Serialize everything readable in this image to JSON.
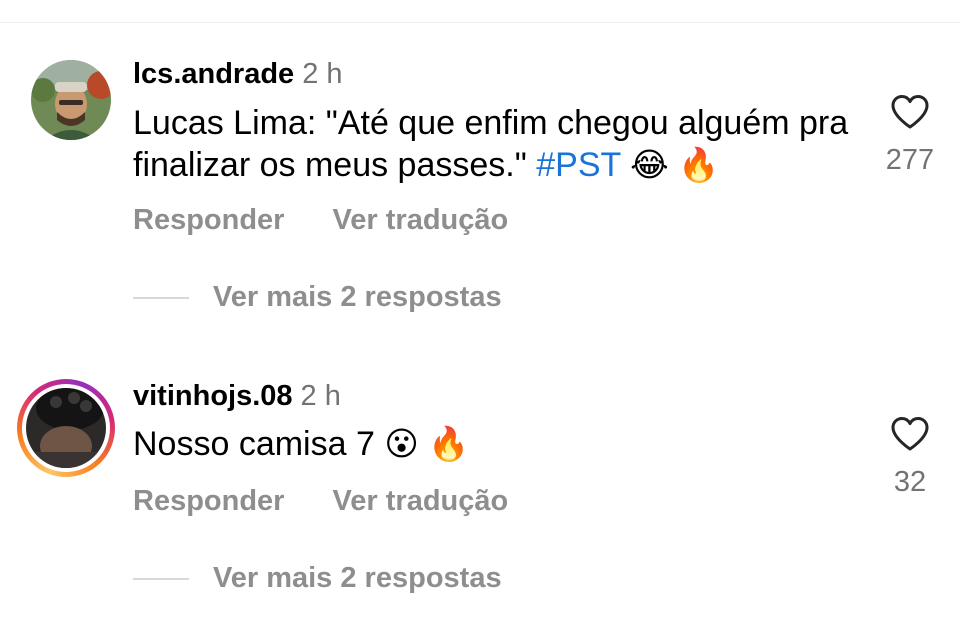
{
  "comments": [
    {
      "username": "lcs.andrade",
      "time": "2 h",
      "text": "Lucas Lima: \"Até que enfim chegou alguém pra finalizar os meus passes.\"",
      "hashtag": "#PST",
      "emojis": [
        "😂",
        "🔥"
      ],
      "reply_label": "Responder",
      "translate_label": "Ver tradução",
      "more_replies": "Ver mais 2 respostas",
      "likes": "277"
    },
    {
      "username": "vitinhojs.08",
      "time": "2 h",
      "text": "Nosso camisa 7",
      "emojis": [
        "😮",
        "🔥"
      ],
      "reply_label": "Responder",
      "translate_label": "Ver tradução",
      "more_replies": "Ver mais 2 respostas",
      "likes": "32",
      "has_story_ring": true
    }
  ],
  "colors": {
    "hashtag": "#1a73d9",
    "secondary_text": "#8e8e8e",
    "time_text": "#737373"
  }
}
